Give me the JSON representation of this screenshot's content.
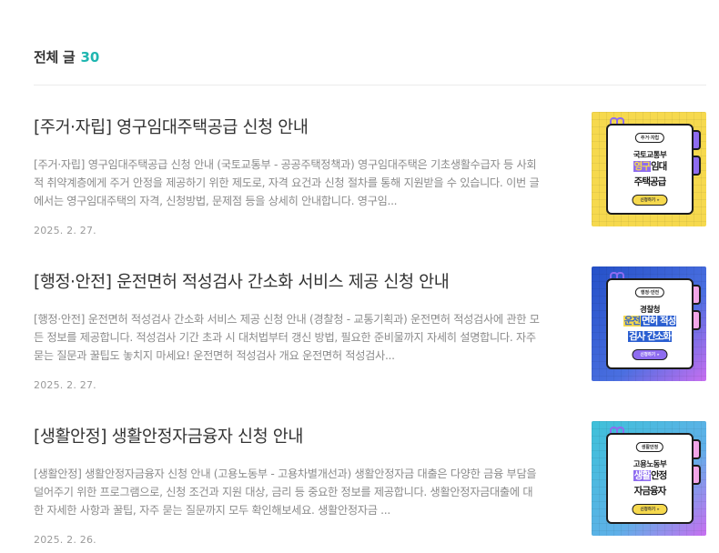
{
  "header": {
    "title": "전체 글",
    "count": "30"
  },
  "posts": [
    {
      "title": "[주거·자립] 영구임대주택공급 신청 안내",
      "excerpt": "[주거·자립] 영구임대주택공급 신청 안내 (국토교통부 - 공공주택정책과) 영구임대주택은 기초생활수급자 등 사회적 취약계층에게 주거 안정을 제공하기 위한 제도로, 자격 요건과 신청 절차를 통해 지원받을 수 있습니다. 이번 글에서는 영구임대주택의 자격, 신청방법, 문제점 등을 상세히 안내합니다. 영구임...",
      "date": "2025. 2. 27.",
      "thumb": {
        "pill": "주거·자립",
        "ministry": "국토교통부",
        "line1_hl": "영구",
        "line1_rest": "임대",
        "line2": "주택공급",
        "apply": "신청하기 »",
        "bg": "#f6d94e",
        "highlight": "#8e6cf0"
      }
    },
    {
      "title": "[행정·안전] 운전면허 적성검사 간소화 서비스 제공 신청 안내",
      "excerpt": "[행정·안전] 운전면허 적성검사 간소화 서비스 제공 신청 안내 (경찰청 - 교통기획과) 운전면허 적성검사에 관한 모든 정보를 제공합니다. 적성검사 기간 초과 시 대처법부터 갱신 방법, 필요한 준비물까지 자세히 설명합니다. 자주 묻는 질문과 꿀팁도 놓치지 마세요! 운전면허 적성검사 개요 운전면허 적성검사...",
      "date": "2025. 2. 27.",
      "thumb": {
        "pill": "행정·안전",
        "ministry": "경찰청",
        "line1_hl": "운전",
        "line1_rest": "면허 적성",
        "line2": "검사 간소화",
        "apply": "신청하기 »",
        "bg": "#2b5fd1",
        "highlight": "#f6d94e"
      }
    },
    {
      "title": "[생활안정] 생활안정자금융자 신청 안내",
      "excerpt": "[생활안정] 생활안정자금융자 신청 안내 (고용노동부 - 고용차별개선과) 생활안정자금 대출은 다양한 금융 부담을 덜어주기 위한 프로그램으로, 신청 조건과 지원 대상, 금리 등 중요한 정보를 제공합니다. 생활안정자금대출에 대한 자세한 사항과 꿀팁, 자주 묻는 질문까지 모두 확인해보세요. 생활안정자금 ...",
      "date": "2025. 2. 26.",
      "thumb": {
        "pill": "생활안정",
        "ministry": "고용노동부",
        "line1_hl": "생활",
        "line1_rest": "안정",
        "line2": "자금융자",
        "apply": "신청하기 »",
        "bg": "#3ec1d9",
        "highlight": "#8e6cf0"
      }
    }
  ]
}
